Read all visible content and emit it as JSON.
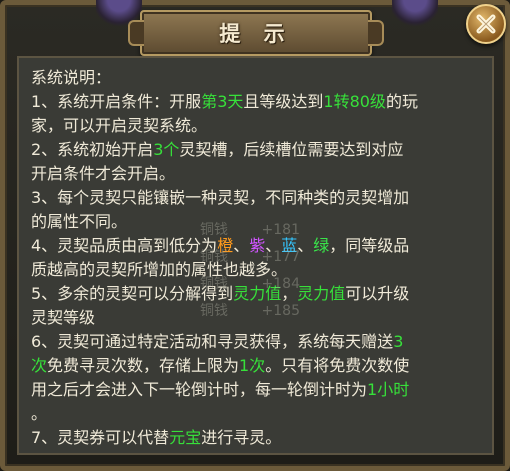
{
  "dialog": {
    "title": "提 示",
    "close_icon": "close-x-icon"
  },
  "content": {
    "heading": "系统说明：",
    "lines": [
      [
        {
          "t": "1、系统开启条件：开服"
        },
        {
          "t": "第3天",
          "c": "green"
        },
        {
          "t": "且等级达到"
        },
        {
          "t": "1转80级",
          "c": "green"
        },
        {
          "t": "的玩"
        }
      ],
      [
        {
          "t": "家，可以开启灵契系统。"
        }
      ],
      [
        {
          "t": "2、系统初始开启"
        },
        {
          "t": "3个",
          "c": "green"
        },
        {
          "t": "灵契槽，后续槽位需要达到对应"
        }
      ],
      [
        {
          "t": "开启条件才会开启。"
        }
      ],
      [
        {
          "t": "3、每个灵契只能镶嵌一种灵契，不同种类的灵契增加"
        }
      ],
      [
        {
          "t": "的属性不同。"
        }
      ],
      [
        {
          "t": "4、灵契品质由高到低分为"
        },
        {
          "t": "橙",
          "c": "orange"
        },
        {
          "t": "、"
        },
        {
          "t": "紫",
          "c": "purple"
        },
        {
          "t": "、"
        },
        {
          "t": "蓝",
          "c": "blue"
        },
        {
          "t": "、"
        },
        {
          "t": "绿",
          "c": "lgreen"
        },
        {
          "t": "，同等级品"
        }
      ],
      [
        {
          "t": "质越高的灵契所增加的属性也越多。"
        }
      ],
      [
        {
          "t": "5、多余的灵契可以分解得到"
        },
        {
          "t": "灵力值",
          "c": "green"
        },
        {
          "t": "，"
        },
        {
          "t": "灵力值",
          "c": "green"
        },
        {
          "t": "可以升级"
        }
      ],
      [
        {
          "t": "灵契等级"
        }
      ],
      [
        {
          "t": "6、灵契可通过特定活动和寻灵获得，系统每天赠送"
        },
        {
          "t": "3",
          "c": "green"
        }
      ],
      [
        {
          "t": "次",
          "c": "green"
        },
        {
          "t": "免费寻灵次数，存储上限为"
        },
        {
          "t": "1次",
          "c": "green"
        },
        {
          "t": "。只有将免费次数使"
        }
      ],
      [
        {
          "t": "用之后才会进入下一轮倒计时，每一轮倒计时为"
        },
        {
          "t": "1小时",
          "c": "green"
        }
      ],
      [
        {
          "t": "。"
        }
      ],
      [
        {
          "t": "7、灵契券可以代替"
        },
        {
          "t": "元宝",
          "c": "green"
        },
        {
          "t": "进行寻灵。"
        }
      ]
    ]
  },
  "floating_rewards": [
    {
      "label": "铜钱",
      "value": "+181"
    },
    {
      "label": "铜钱",
      "value": "+177"
    },
    {
      "label": "铜钱",
      "value": "+184"
    },
    {
      "label": "铜钱",
      "value": "+185"
    }
  ]
}
